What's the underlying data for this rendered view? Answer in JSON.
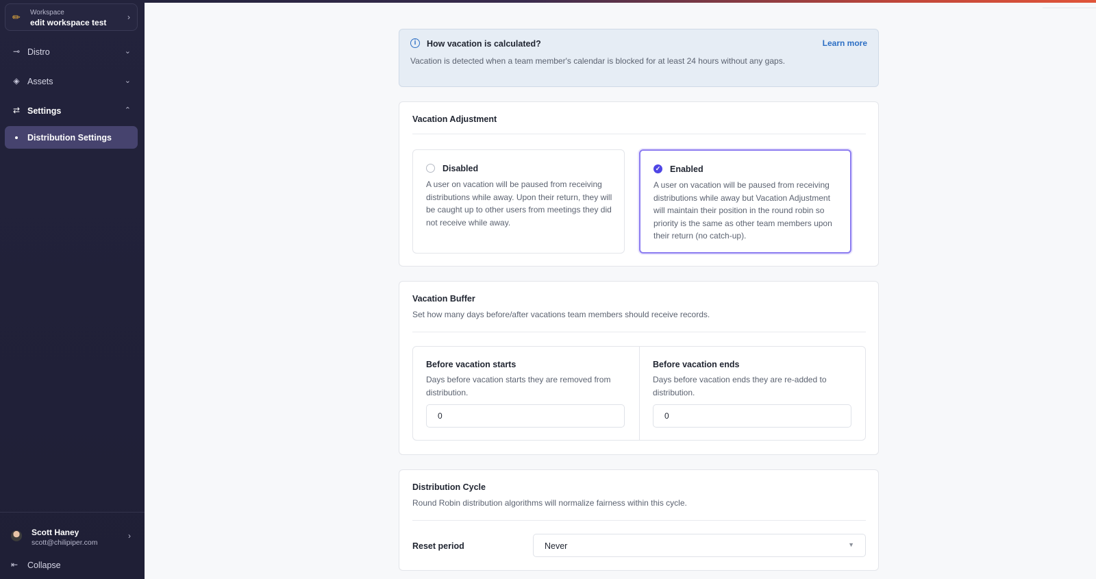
{
  "sidebar": {
    "workspace": {
      "label": "Workspace",
      "name": "edit workspace test"
    },
    "nav": [
      {
        "label": "Distro"
      },
      {
        "label": "Assets"
      },
      {
        "label": "Settings"
      }
    ],
    "sub_item": {
      "label": "Distribution Settings"
    },
    "user": {
      "name": "Scott Haney",
      "email": "scott@chilipiper.com"
    },
    "collapse_label": "Collapse"
  },
  "info": {
    "title": "How vacation is calculated?",
    "text": "Vacation is detected when a team member's calendar is blocked for at least 24 hours without any gaps.",
    "link": "Learn more"
  },
  "vacation_adjustment": {
    "title": "Vacation Adjustment",
    "options": [
      {
        "title": "Disabled",
        "text": "A user on vacation will be paused from receiving distributions while away. Upon their return, they will be caught up to other users from meetings they did not receive while away.",
        "selected": false
      },
      {
        "title": "Enabled",
        "text": "A user on vacation will be paused from receiving distributions while away but Vacation Adjustment will maintain their position in the round robin so priority is the same as other team members upon their return (no catch-up).",
        "selected": true
      }
    ]
  },
  "vacation_buffer": {
    "title": "Vacation Buffer",
    "description": "Set how many days before/after vacations team members should receive records.",
    "before_start": {
      "title": "Before vacation starts",
      "text": "Days before vacation starts they are removed from distribution.",
      "value": "0"
    },
    "before_end": {
      "title": "Before vacation ends",
      "text": "Days before vacation ends they are re-added to distribution.",
      "value": "0"
    }
  },
  "distribution_cycle": {
    "title": "Distribution Cycle",
    "description": "Round Robin distribution algorithms will normalize fairness within this cycle.",
    "reset_label": "Reset period",
    "reset_value": "Never"
  },
  "colors": {
    "accent": "#4f46e5",
    "link": "#2d6fc4",
    "sidebar": "#23233c"
  }
}
